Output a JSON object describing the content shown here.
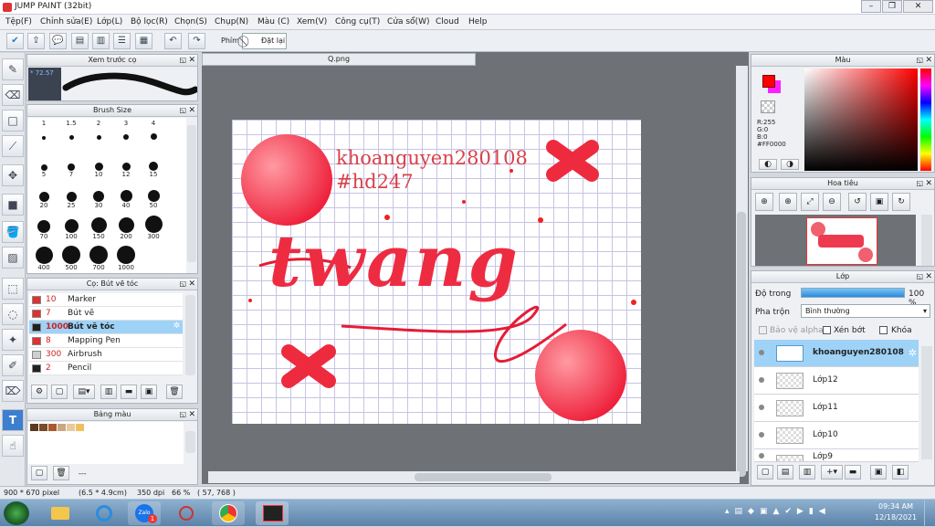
{
  "window": {
    "title": "JUMP PAINT (32bit)"
  },
  "menu": [
    "Tệp(F)",
    "Chỉnh sửa(E)",
    "Lớp(L)",
    "Bộ lọc(R)",
    "Chọn(S)",
    "Chụp(N)",
    "Màu (C)",
    "Xem(V)",
    "Công cụ(T)",
    "Cửa sổ(W)",
    "Cloud",
    "Help"
  ],
  "toolbar": {
    "shortcut_label": "Phím",
    "reset_label": "Đặt lại"
  },
  "brush_preview": {
    "title": "Xem trước cọ",
    "opacity_text": "* 72.57"
  },
  "brush_size": {
    "title": "Brush Size",
    "sizes": [
      "1",
      "1.5",
      "2",
      "3",
      "4",
      "5",
      "7",
      "10",
      "12",
      "15",
      "20",
      "25",
      "30",
      "40",
      "50",
      "70",
      "100",
      "150",
      "200",
      "300",
      "400",
      "500",
      "700",
      "1000"
    ]
  },
  "brush_list": {
    "title": "Cọ: Bút vẽ tóc",
    "items": [
      {
        "size": "10",
        "name": "Marker",
        "color": "#e03030"
      },
      {
        "size": "7",
        "name": "Bút vẽ",
        "color": "#e03030"
      },
      {
        "size": "1000",
        "name": "Bút vẽ tóc",
        "color": "#202020"
      },
      {
        "size": "8",
        "name": "Mapping Pen",
        "color": "#e03030"
      },
      {
        "size": "300",
        "name": "Airbrush",
        "color": "#cfcfcf"
      },
      {
        "size": "2",
        "name": "Pencil",
        "color": "#202020"
      }
    ]
  },
  "palette": {
    "title": "Bảng màu",
    "swatches": [
      "#5a3a22",
      "#7a4a2a",
      "#a85a30",
      "#c9a780",
      "#e9c9a0",
      "#f0c060"
    ],
    "footer": "---"
  },
  "document": {
    "tab": "Q.png"
  },
  "artwork": {
    "watermark1": "khoanguyen280108",
    "watermark2": "#hd247",
    "word": "twang"
  },
  "color_panel": {
    "title": "Màu",
    "r": "R:255",
    "g": "G:0",
    "b": "B:0",
    "hex": "#FF0000",
    "fg": "#FF0000"
  },
  "navigator": {
    "title": "Hoa tiêu"
  },
  "layers": {
    "title": "Lớp",
    "opacity_label": "Độ trong",
    "opacity_value": "100 %",
    "opacity_fraction": 1.0,
    "blend_label": "Pha trộn",
    "blend_value": "Bình thường",
    "protect_alpha": "Bảo vệ alpha",
    "clipping": "Xén bớt",
    "lock": "Khóa",
    "items": [
      "khoanguyen280108",
      "Lớp12",
      "Lớp11",
      "Lớp10",
      "Lớp9"
    ]
  },
  "status": {
    "dims": "900 * 670 pixel",
    "size_cm": "(6.5 * 4.9cm)",
    "dpi": "350 dpi",
    "zoom": "66 %",
    "coords": "( 57, 768 )"
  },
  "taskbar": {
    "time": "09:34 AM",
    "date": "12/18/2021",
    "badge": "1"
  }
}
